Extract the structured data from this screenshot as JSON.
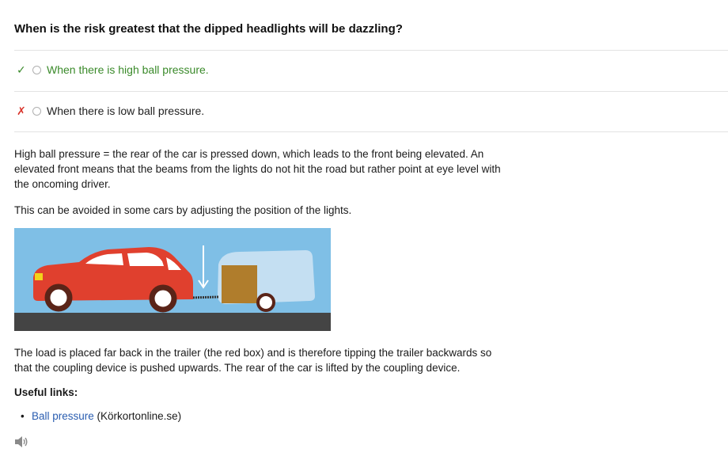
{
  "question": "When is the risk greatest that the dipped headlights will be dazzling?",
  "answers": [
    {
      "mark": "✓",
      "text": "When there is high ball pressure.",
      "status": "correct"
    },
    {
      "mark": "✗",
      "text": "When there is low ball pressure.",
      "status": "wrong"
    }
  ],
  "explanation": {
    "p1": "High ball pressure = the rear of the car is pressed down, which leads to the front being elevated. An elevated front means that the beams from the lights do not hit the road but rather point at eye level with the oncoming driver.",
    "p2": "This can be avoided in some cars by adjusting the position of the lights.",
    "p3": "The load is placed far back in the trailer (the red box) and is therefore tipping the trailer backwards so that the coupling device is pushed upwards. The rear of the car is lifted by the coupling device."
  },
  "useful_links": {
    "heading": "Useful links:",
    "items": [
      {
        "link_text": "Ball pressure",
        "source": " (Körkortonline.se)"
      }
    ]
  },
  "icons": {
    "audio": "speaker-icon",
    "correct": "check-icon",
    "wrong": "cross-icon"
  },
  "colors": {
    "correct": "#3a8a2a",
    "wrong": "#d9342b",
    "link": "#2a5db0",
    "sky": "#7fbfe6",
    "road": "#444444",
    "car": "#e0402e",
    "box": "#b07d2c"
  }
}
